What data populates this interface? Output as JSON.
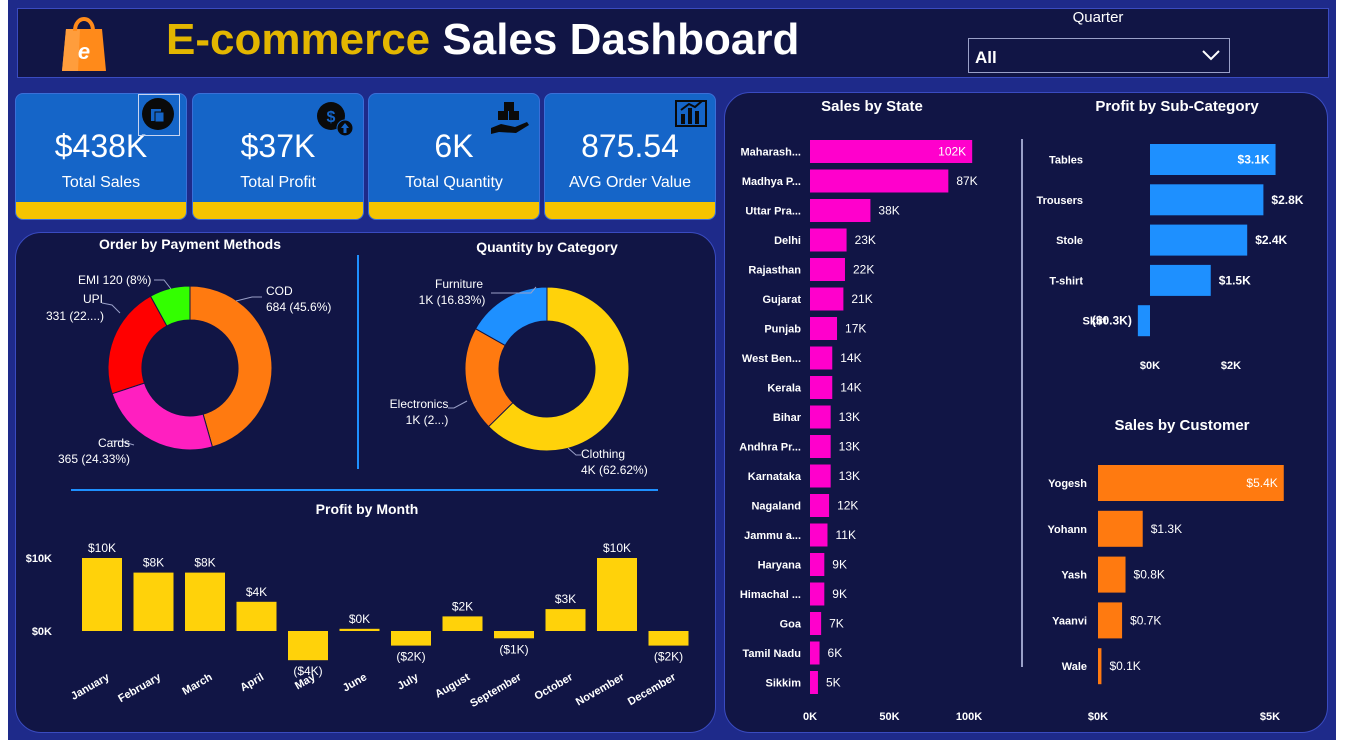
{
  "header": {
    "title_part1": "E-commerce",
    "title_part2": "Sales Dashboard",
    "logo_icon": "shopping-bag-icon",
    "filter": {
      "label": "Quarter",
      "selected": "All",
      "icon": "chevron-down-icon"
    }
  },
  "kpis": [
    {
      "value": "$438K",
      "label": "Total Sales",
      "icon": "shopping-bag-icon"
    },
    {
      "value": "$37K",
      "label": "Total Profit",
      "icon": "money-bag-icon"
    },
    {
      "value": "6K",
      "label": "Total Quantity",
      "icon": "boxes-in-hand-icon"
    },
    {
      "value": "875.54",
      "label": "AVG Order Value",
      "icon": "bar-chart-icon"
    }
  ],
  "colors": {
    "background": "#1e2a8a",
    "panel": "#111545",
    "kpi_card": "#1565c8",
    "kpi_accent": "#f5c400",
    "title_accent": "#e3b600",
    "state_bars": "#ff00cc",
    "subcategory_bars": "#1e90ff",
    "customer_bars": "#ff7a10",
    "month_bars": "#ffd20a"
  },
  "chart_data": [
    {
      "id": "payment",
      "type": "pie",
      "variant": "donut",
      "title": "Order by Payment Methods",
      "slices": [
        {
          "name": "COD",
          "value": 684,
          "label": "684 (45.6%)",
          "color": "#ff7a10"
        },
        {
          "name": "Cards",
          "value": 365,
          "label": "365 (24.33%)",
          "color": "#ff1fc0"
        },
        {
          "name": "UPI",
          "value": 331,
          "label": "331 (22....)",
          "color": "#ff0000"
        },
        {
          "name": "EMI",
          "value": 120,
          "label": "EMI 120 (8%)",
          "color": "#33ff00"
        }
      ]
    },
    {
      "id": "category",
      "type": "pie",
      "variant": "donut",
      "title": "Quantity by Category",
      "slices": [
        {
          "name": "Clothing",
          "value": 62.62,
          "label": "4K (62.62%)",
          "color": "#ffd20a"
        },
        {
          "name": "Electronics",
          "value": 20.55,
          "label": "1K (2...)",
          "color": "#ff7a10"
        },
        {
          "name": "Furniture",
          "value": 16.83,
          "label": "1K (16.83%)",
          "color": "#1e90ff"
        }
      ]
    },
    {
      "id": "month",
      "type": "bar",
      "title": "Profit by Month",
      "categories": [
        "January",
        "February",
        "March",
        "April",
        "May",
        "June",
        "July",
        "August",
        "September",
        "October",
        "November",
        "December"
      ],
      "values": [
        10,
        8,
        8,
        4,
        -4,
        0.3,
        -2,
        2,
        -1,
        3,
        10,
        -2
      ],
      "data_labels": [
        "$10K",
        "$8K",
        "$8K",
        "$4K",
        "($4K)",
        "$0K",
        "($2K)",
        "$2K",
        "($1K)",
        "$3K",
        "$10K",
        "($2K)"
      ],
      "y_ticks": [
        {
          "value": 10,
          "label": "$10K"
        },
        {
          "value": 0,
          "label": "$0K"
        }
      ],
      "unit": "$K",
      "color": "#ffd20a"
    },
    {
      "id": "state",
      "type": "bar",
      "orientation": "horizontal",
      "title": "Sales by State",
      "categories": [
        "Maharash...",
        "Madhya P...",
        "Uttar Pra...",
        "Delhi",
        "Rajasthan",
        "Gujarat",
        "Punjab",
        "West Ben...",
        "Kerala",
        "Bihar",
        "Andhra Pr...",
        "Karnataka",
        "Nagaland",
        "Jammu a...",
        "Haryana",
        "Himachal ...",
        "Goa",
        "Tamil Nadu",
        "Sikkim"
      ],
      "values": [
        102,
        87,
        38,
        23,
        22,
        21,
        17,
        14,
        14,
        13,
        13,
        13,
        12,
        11,
        9,
        9,
        7,
        6,
        5
      ],
      "data_labels": [
        "102K",
        "87K",
        "38K",
        "23K",
        "22K",
        "21K",
        "17K",
        "14K",
        "14K",
        "13K",
        "13K",
        "13K",
        "12K",
        "11K",
        "9K",
        "9K",
        "7K",
        "6K",
        "5K"
      ],
      "x_ticks": [
        {
          "value": 0,
          "label": "0K"
        },
        {
          "value": 50,
          "label": "50K"
        },
        {
          "value": 100,
          "label": "100K"
        }
      ],
      "xlim": [
        0,
        100
      ],
      "unit": "K",
      "color": "#ff00cc"
    },
    {
      "id": "subcat",
      "type": "bar",
      "orientation": "horizontal",
      "title": "Profit by Sub-Category",
      "categories": [
        "Tables",
        "Trousers",
        "Stole",
        "T-shirt",
        "Skirt"
      ],
      "values": [
        3.1,
        2.8,
        2.4,
        1.5,
        -0.3
      ],
      "data_labels": [
        "$3.1K",
        "$2.8K",
        "$2.4K",
        "$1.5K",
        "($0.3K)"
      ],
      "x_ticks": [
        {
          "value": 0,
          "label": "$0K"
        },
        {
          "value": 2,
          "label": "$2K"
        }
      ],
      "unit": "$K",
      "color": "#1e90ff"
    },
    {
      "id": "customer",
      "type": "bar",
      "orientation": "horizontal",
      "title": "Sales by Customer",
      "categories": [
        "Yogesh",
        "Yohann",
        "Yash",
        "Yaanvi",
        "Wale"
      ],
      "values": [
        5.4,
        1.3,
        0.8,
        0.7,
        0.1
      ],
      "data_labels": [
        "$5.4K",
        "$1.3K",
        "$0.8K",
        "$0.7K",
        "$0.1K"
      ],
      "x_ticks": [
        {
          "value": 0,
          "label": "$0K"
        },
        {
          "value": 5,
          "label": "$5K"
        }
      ],
      "xlim": [
        0,
        5
      ],
      "unit": "$K",
      "color": "#ff7a10"
    }
  ]
}
